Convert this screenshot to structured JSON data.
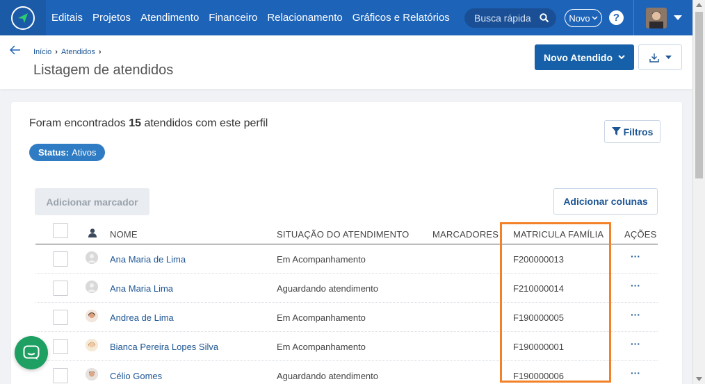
{
  "nav": {
    "items": [
      "Editais",
      "Projetos",
      "Atendimento",
      "Financeiro",
      "Relacionamento",
      "Gráficos e Relatórios"
    ],
    "search_placeholder": "Busca rápida",
    "novo_label": "Novo",
    "help_label": "?"
  },
  "header": {
    "breadcrumb": [
      "Início",
      "Atendidos"
    ],
    "title": "Listagem de atendidos",
    "new_button": "Novo Atendido"
  },
  "summary": {
    "prefix": "Foram encontrados",
    "count": "15",
    "suffix": "atendidos com este perfil",
    "filters_button": "Filtros",
    "status_key": "Status:",
    "status_value": "Ativos"
  },
  "actions": {
    "add_marker": "Adicionar marcador",
    "add_columns": "Adicionar colunas"
  },
  "table": {
    "columns": {
      "name": "NOME",
      "status": "SITUAÇÃO DO ATENDIMENTO",
      "markers": "MARCADORES",
      "matricula": "MATRICULA FAMÍLIA",
      "actions": "AÇÕES"
    },
    "rows": [
      {
        "name": "Ana Maria de Lima",
        "status": "Em Acompanhamento",
        "matricula": "F200000013",
        "actions": "···",
        "avatar": "default-avatar-icon"
      },
      {
        "name": "Ana Maria Lima",
        "status": "Aguardando atendimento",
        "matricula": "F210000014",
        "actions": "···",
        "avatar": "default-avatar-icon"
      },
      {
        "name": "Andrea de Lima",
        "status": "Em Acompanhamento",
        "matricula": "F190000005",
        "actions": "···",
        "avatar": "photo-avatar"
      },
      {
        "name": "Bianca Pereira Lopes Silva",
        "status": "Em Acompanhamento",
        "matricula": "F190000001",
        "actions": "···",
        "avatar": "photo-avatar"
      },
      {
        "name": "Célio Gomes",
        "status": "Aguardando atendimento",
        "matricula": "F190000006",
        "actions": "···",
        "avatar": "photo-avatar"
      }
    ]
  },
  "colors": {
    "nav_bg": "#1d63b8",
    "primary_button": "#1560a8",
    "link": "#1d5593",
    "status_chip": "#2f7cc4",
    "highlight": "#f28127",
    "chat": "#1fa063"
  }
}
